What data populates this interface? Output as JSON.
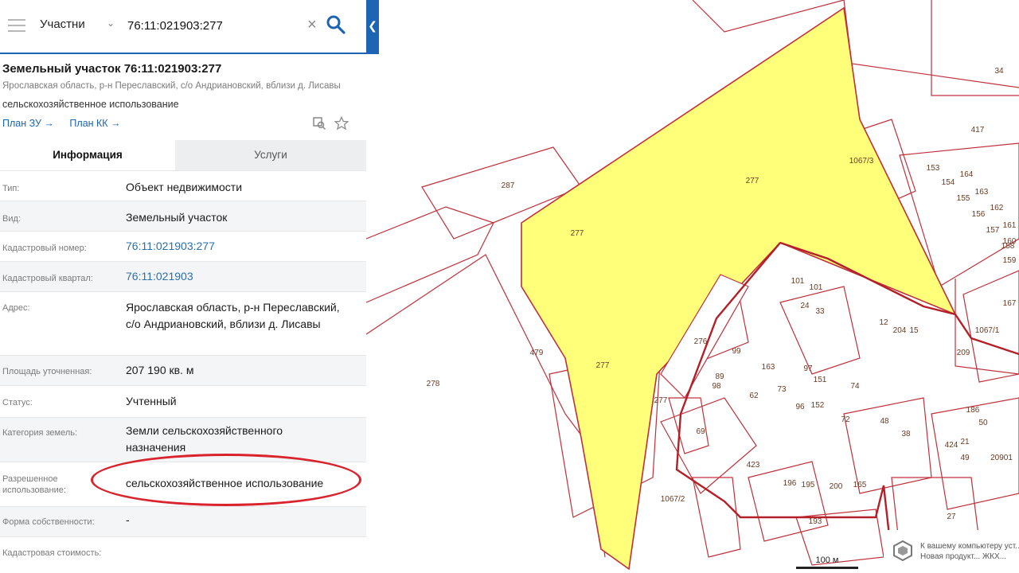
{
  "search": {
    "filter_label": "Участни",
    "query": "76:11:021903:277"
  },
  "object": {
    "title": "Земельный участок 76:11:021903:277",
    "address_short": "Ярославская область, р-н Переславский, с/о Андриановский, вблизи д. Лисавы",
    "use_short": "сельскохозяйственное использование",
    "links": [
      "План ЗУ →",
      "План КК →"
    ]
  },
  "tabs": [
    {
      "label": "Информация",
      "active": true
    },
    {
      "label": "Услуги",
      "active": false
    }
  ],
  "info": [
    {
      "label": "Тип:",
      "value": "Объект недвижимости"
    },
    {
      "label": "Вид:",
      "value": "Земельный участок"
    },
    {
      "label": "Кадастровый номер:",
      "value": "76:11:021903:277"
    },
    {
      "label": "Кадастровый квартал:",
      "value": "76:11:021903"
    },
    {
      "label": "Адрес:",
      "value": "Ярославская область, р-н Переславский, с/о Андриановский, вблизи д. Лисавы"
    },
    {
      "label": "Площадь уточненная:",
      "value": "207 190 кв. м"
    },
    {
      "label": "Статус:",
      "value": "Учтенный"
    },
    {
      "label": "Категория земель:",
      "value": "Земли сельскохозяйственного назначения"
    },
    {
      "label": "Разрешенное использование:",
      "value": "сельскохозяйственное использование"
    },
    {
      "label": "Форма собственности:",
      "value": "-"
    },
    {
      "label": "Кадастровая стоимость:",
      "value": ""
    }
  ],
  "map": {
    "highlight_color": "#ffff7a",
    "boundary_color": "#c0303a",
    "labels": [
      "277",
      "277",
      "277",
      "277",
      "287",
      "278",
      "479",
      "276",
      "34",
      "417",
      "1067/3",
      "1067/1",
      "1067/2",
      "153",
      "154",
      "155",
      "156",
      "157",
      "158",
      "159",
      "164",
      "163",
      "162",
      "161",
      "160",
      "167",
      "101",
      "101",
      "24",
      "33",
      "12",
      "204",
      "15",
      "209",
      "99",
      "89",
      "98",
      "62",
      "163",
      "97",
      "151",
      "73",
      "96",
      "152",
      "74",
      "72",
      "48",
      "38",
      "69",
      "423",
      "196",
      "195",
      "200",
      "165",
      "193",
      "186",
      "50",
      "21",
      "424",
      "49",
      "27",
      "20901"
    ],
    "scale_label": "100 м",
    "notice": "К вашему компьютеру уст... Новая продукт... ЖКХ..."
  }
}
